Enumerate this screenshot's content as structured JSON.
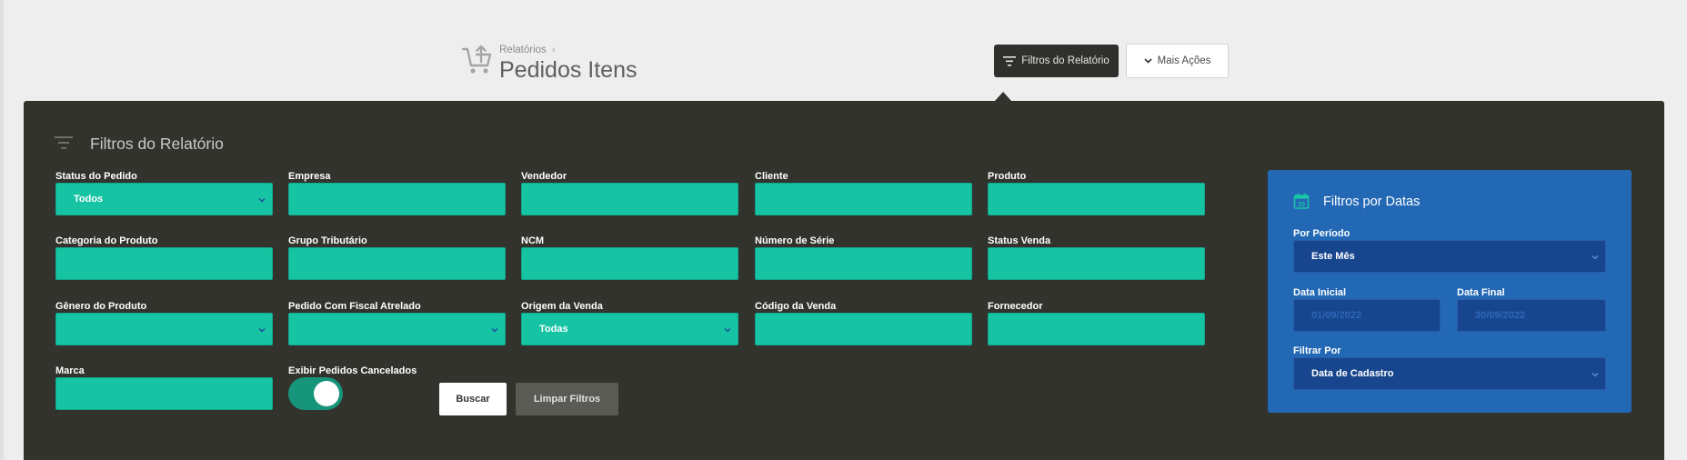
{
  "header": {
    "breadcrumb": "Relatórios",
    "breadcrumb_sep": "›",
    "title": "Pedidos Itens",
    "btn_filters": "Filtros do Relatório",
    "btn_more": "Mais Ações"
  },
  "panel": {
    "title": "Filtros do Relatório",
    "fields": {
      "status_pedido": {
        "label": "Status do Pedido",
        "value": "Todos"
      },
      "empresa": {
        "label": "Empresa",
        "value": ""
      },
      "vendedor": {
        "label": "Vendedor",
        "value": ""
      },
      "cliente": {
        "label": "Cliente",
        "value": ""
      },
      "produto": {
        "label": "Produto",
        "value": ""
      },
      "categoria_produto": {
        "label": "Categoria do Produto",
        "value": ""
      },
      "grupo_tributario": {
        "label": "Grupo Tributário",
        "value": ""
      },
      "ncm": {
        "label": "NCM",
        "value": ""
      },
      "numero_serie": {
        "label": "Número de Série",
        "value": ""
      },
      "status_venda": {
        "label": "Status Venda",
        "value": ""
      },
      "genero_produto": {
        "label": "Gênero do Produto",
        "value": ""
      },
      "pedido_fiscal": {
        "label": "Pedido Com Fiscal Atrelado",
        "value": ""
      },
      "origem_venda": {
        "label": "Origem da Venda",
        "value": "Todas"
      },
      "codigo_venda": {
        "label": "Código da Venda",
        "value": ""
      },
      "fornecedor": {
        "label": "Fornecedor",
        "value": ""
      },
      "marca": {
        "label": "Marca",
        "value": ""
      },
      "exibir_cancelados": {
        "label": "Exibir Pedidos Cancelados",
        "checked": true
      }
    },
    "btn_buscar": "Buscar",
    "btn_limpar": "Limpar Filtros"
  },
  "dates": {
    "title": "Filtros por Datas",
    "por_periodo": {
      "label": "Por Período",
      "value": "Este Mês"
    },
    "data_inicial": {
      "label": "Data Inicial",
      "placeholder": "01/09/2022"
    },
    "data_final": {
      "label": "Data Final",
      "placeholder": "30/09/2022"
    },
    "filtrar_por": {
      "label": "Filtrar Por",
      "value": "Data de Cadastro"
    }
  },
  "colors": {
    "panel_bg": "#33332e",
    "field_teal": "#16c4a4",
    "date_panel_blue": "#2268b5",
    "date_input_blue": "#17468e"
  }
}
